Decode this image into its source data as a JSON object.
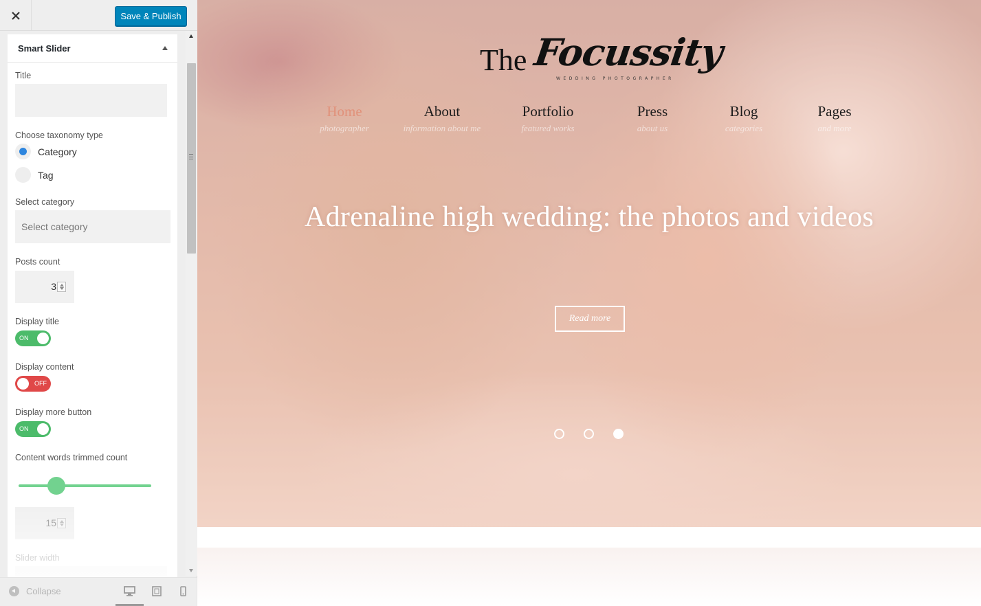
{
  "customizer": {
    "publish_label": "Save & Publish",
    "section_title": "Smart Slider",
    "title_label": "Title",
    "title_value": "",
    "taxonomy_label": "Choose taxonomy type",
    "taxonomy_options": [
      "Category",
      "Tag"
    ],
    "taxonomy_selected": "Category",
    "category_label": "Select category",
    "category_placeholder": "Select category",
    "posts_count_label": "Posts count",
    "posts_count": "3",
    "display_title_label": "Display title",
    "display_title": "ON",
    "display_content_label": "Display content",
    "display_content": "OFF",
    "display_more_label": "Display more button",
    "display_more": "ON",
    "words_label": "Content words trimmed count",
    "words_count": "15",
    "words_slider_fraction": 0.3,
    "slider_width_label": "Slider width",
    "collapse_label": "Collapse",
    "accent_on": "#4cbb6a",
    "accent_off": "#e04848",
    "publish_color": "#0085ba"
  },
  "site": {
    "logo_the": "The",
    "logo_script": "Focussity",
    "logo_tagline": "WEDDING PHOTOGRAPHER",
    "nav": [
      {
        "title": "Home",
        "sub": "photographer",
        "active": true
      },
      {
        "title": "About",
        "sub": "information about me"
      },
      {
        "title": "Portfolio",
        "sub": "featured works"
      },
      {
        "title": "Press",
        "sub": "about us"
      },
      {
        "title": "Blog",
        "sub": "categories"
      },
      {
        "title": "Pages",
        "sub": "and more"
      }
    ],
    "hero_title": "Adrenaline high wedding: the photos and videos",
    "read_more": "Read more",
    "slides": 3,
    "active_slide": 3,
    "active_nav_color": "#e1917a"
  }
}
